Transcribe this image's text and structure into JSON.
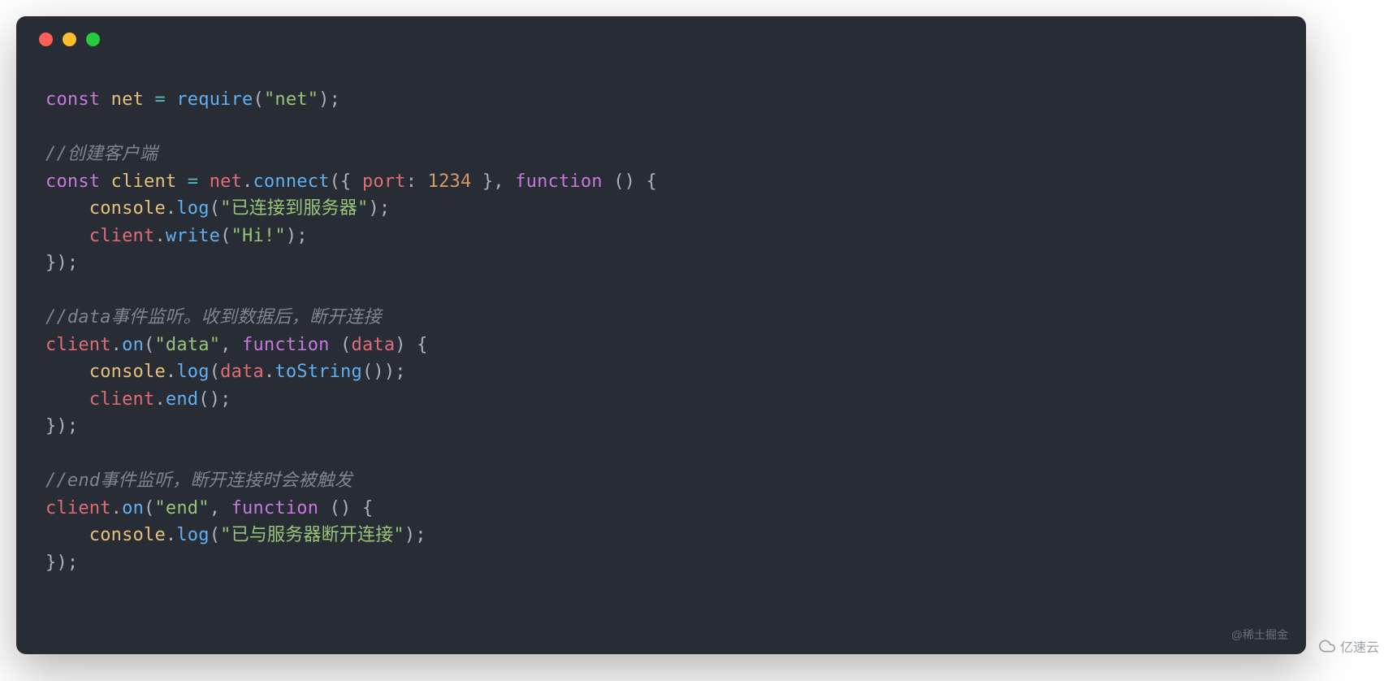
{
  "theme": {
    "background": "#282c34",
    "foreground": "#abb2bf",
    "red": "#ff5f56",
    "yellow": "#ffbd2e",
    "green": "#27c93f"
  },
  "code": {
    "lines": [
      [
        {
          "t": "const ",
          "c": "tok-keyword"
        },
        {
          "t": "net",
          "c": "tok-const-name"
        },
        {
          "t": " = ",
          "c": "tok-operator"
        },
        {
          "t": "require",
          "c": "tok-func"
        },
        {
          "t": "(",
          "c": "tok-punct"
        },
        {
          "t": "\"net\"",
          "c": "tok-string"
        },
        {
          "t": ");",
          "c": "tok-punct"
        }
      ],
      [],
      [
        {
          "t": "//创建客户端",
          "c": "tok-comment"
        }
      ],
      [
        {
          "t": "const ",
          "c": "tok-keyword"
        },
        {
          "t": "client",
          "c": "tok-const-name"
        },
        {
          "t": " = ",
          "c": "tok-operator"
        },
        {
          "t": "net",
          "c": "tok-var-name"
        },
        {
          "t": ".",
          "c": "tok-punct"
        },
        {
          "t": "connect",
          "c": "tok-func"
        },
        {
          "t": "({ ",
          "c": "tok-punct"
        },
        {
          "t": "port",
          "c": "tok-property"
        },
        {
          "t": ": ",
          "c": "tok-punct"
        },
        {
          "t": "1234",
          "c": "tok-number"
        },
        {
          "t": " }, ",
          "c": "tok-punct"
        },
        {
          "t": "function ",
          "c": "tok-keyword"
        },
        {
          "t": "() {",
          "c": "tok-punct"
        }
      ],
      [
        {
          "t": "    ",
          "c": "tok-default"
        },
        {
          "t": "console",
          "c": "tok-builtin"
        },
        {
          "t": ".",
          "c": "tok-punct"
        },
        {
          "t": "log",
          "c": "tok-func"
        },
        {
          "t": "(",
          "c": "tok-punct"
        },
        {
          "t": "\"已连接到服务器\"",
          "c": "tok-string"
        },
        {
          "t": ");",
          "c": "tok-punct"
        }
      ],
      [
        {
          "t": "    ",
          "c": "tok-default"
        },
        {
          "t": "client",
          "c": "tok-var-name"
        },
        {
          "t": ".",
          "c": "tok-punct"
        },
        {
          "t": "write",
          "c": "tok-func"
        },
        {
          "t": "(",
          "c": "tok-punct"
        },
        {
          "t": "\"Hi!\"",
          "c": "tok-string"
        },
        {
          "t": ");",
          "c": "tok-punct"
        }
      ],
      [
        {
          "t": "});",
          "c": "tok-punct"
        }
      ],
      [],
      [
        {
          "t": "//data事件监听。收到数据后，断开连接",
          "c": "tok-comment"
        }
      ],
      [
        {
          "t": "client",
          "c": "tok-var-name"
        },
        {
          "t": ".",
          "c": "tok-punct"
        },
        {
          "t": "on",
          "c": "tok-func"
        },
        {
          "t": "(",
          "c": "tok-punct"
        },
        {
          "t": "\"data\"",
          "c": "tok-string"
        },
        {
          "t": ", ",
          "c": "tok-punct"
        },
        {
          "t": "function ",
          "c": "tok-keyword"
        },
        {
          "t": "(",
          "c": "tok-punct"
        },
        {
          "t": "data",
          "c": "tok-param"
        },
        {
          "t": ") {",
          "c": "tok-punct"
        }
      ],
      [
        {
          "t": "    ",
          "c": "tok-default"
        },
        {
          "t": "console",
          "c": "tok-builtin"
        },
        {
          "t": ".",
          "c": "tok-punct"
        },
        {
          "t": "log",
          "c": "tok-func"
        },
        {
          "t": "(",
          "c": "tok-punct"
        },
        {
          "t": "data",
          "c": "tok-var-name"
        },
        {
          "t": ".",
          "c": "tok-punct"
        },
        {
          "t": "toString",
          "c": "tok-func"
        },
        {
          "t": "());",
          "c": "tok-punct"
        }
      ],
      [
        {
          "t": "    ",
          "c": "tok-default"
        },
        {
          "t": "client",
          "c": "tok-var-name"
        },
        {
          "t": ".",
          "c": "tok-punct"
        },
        {
          "t": "end",
          "c": "tok-func"
        },
        {
          "t": "();",
          "c": "tok-punct"
        }
      ],
      [
        {
          "t": "});",
          "c": "tok-punct"
        }
      ],
      [],
      [
        {
          "t": "//end事件监听，断开连接时会被触发",
          "c": "tok-comment"
        }
      ],
      [
        {
          "t": "client",
          "c": "tok-var-name"
        },
        {
          "t": ".",
          "c": "tok-punct"
        },
        {
          "t": "on",
          "c": "tok-func"
        },
        {
          "t": "(",
          "c": "tok-punct"
        },
        {
          "t": "\"end\"",
          "c": "tok-string"
        },
        {
          "t": ", ",
          "c": "tok-punct"
        },
        {
          "t": "function ",
          "c": "tok-keyword"
        },
        {
          "t": "() {",
          "c": "tok-punct"
        }
      ],
      [
        {
          "t": "    ",
          "c": "tok-default"
        },
        {
          "t": "console",
          "c": "tok-builtin"
        },
        {
          "t": ".",
          "c": "tok-punct"
        },
        {
          "t": "log",
          "c": "tok-func"
        },
        {
          "t": "(",
          "c": "tok-punct"
        },
        {
          "t": "\"已与服务器断开连接\"",
          "c": "tok-string"
        },
        {
          "t": ");",
          "c": "tok-punct"
        }
      ],
      [
        {
          "t": "});",
          "c": "tok-punct"
        }
      ]
    ]
  },
  "watermarks": {
    "juejin": "@稀土掘金",
    "yisu": "亿速云"
  }
}
